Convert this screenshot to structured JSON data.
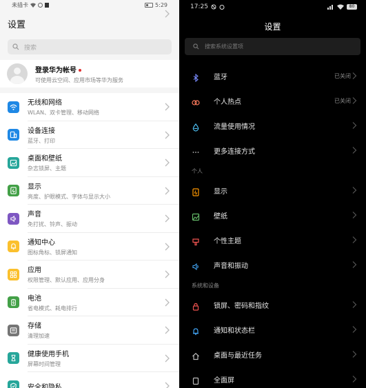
{
  "left": {
    "status": {
      "left": "未插卡",
      "time": "5:29"
    },
    "title": "设置",
    "search_placeholder": "搜索",
    "account": {
      "name": "登录华为帐号",
      "sub": "可使用云空间、应用市场等华为服务"
    },
    "items": [
      {
        "label": "无线和网络",
        "sub": "WLAN、双卡管理、移动网络",
        "color": "#1e88e5",
        "icon": "wifi-icon"
      },
      {
        "label": "设备连接",
        "sub": "蓝牙、打印",
        "color": "#1e88e5",
        "icon": "device-connect-icon"
      },
      {
        "label": "桌面和壁纸",
        "sub": "杂志锁屏、主题",
        "color": "#26a69a",
        "icon": "wallpaper-icon"
      },
      {
        "label": "显示",
        "sub": "亮度、护眼模式、字体与显示大小",
        "color": "#43a047",
        "icon": "display-icon"
      },
      {
        "label": "声音",
        "sub": "免打扰、铃声、振动",
        "color": "#7e57c2",
        "icon": "sound-icon"
      },
      {
        "label": "通知中心",
        "sub": "图标角标、锁屏通知",
        "color": "#fbc02d",
        "icon": "notification-icon"
      },
      {
        "label": "应用",
        "sub": "权限管理、默认应用、应用分身",
        "color": "#fbc02d",
        "icon": "apps-icon"
      },
      {
        "label": "电池",
        "sub": "省电模式、耗电排行",
        "color": "#43a047",
        "icon": "battery-icon"
      },
      {
        "label": "存储",
        "sub": "清理加速",
        "color": "#757575",
        "icon": "storage-icon"
      },
      {
        "label": "健康使用手机",
        "sub": "屏幕时间管理",
        "color": "#26a69a",
        "icon": "hourglass-icon"
      },
      {
        "label": "安全和隐私",
        "sub": "",
        "color": "#26a69a",
        "icon": "shield-icon"
      }
    ]
  },
  "right": {
    "status": {
      "time": "17:25",
      "battery": "80"
    },
    "title": "设置",
    "search_placeholder": "搜索系统设置项",
    "group1": [
      {
        "label": "蓝牙",
        "value": "已关闭",
        "icon": "bluetooth-icon",
        "color": "#7a8cff"
      },
      {
        "label": "个人热点",
        "value": "已关闭",
        "icon": "hotspot-icon",
        "color": "#ff7b5c"
      },
      {
        "label": "流量使用情况",
        "value": "",
        "icon": "data-usage-icon",
        "color": "#4fc3f7"
      },
      {
        "label": "更多连接方式",
        "value": "",
        "icon": "more-icon",
        "color": "#bbbbbb"
      }
    ],
    "header2": "个人",
    "group2": [
      {
        "label": "显示",
        "icon": "display-icon",
        "color": "#ff9800"
      },
      {
        "label": "壁纸",
        "icon": "wallpaper-icon",
        "color": "#66bb6a"
      },
      {
        "label": "个性主题",
        "icon": "theme-icon",
        "color": "#ef5350"
      },
      {
        "label": "声音和振动",
        "icon": "sound-icon",
        "color": "#42a5f5"
      }
    ],
    "header3": "系统和设备",
    "group3": [
      {
        "label": "锁屏、密码和指纹",
        "icon": "lock-icon",
        "color": "#ef5350"
      },
      {
        "label": "通知和状态栏",
        "icon": "notification-icon",
        "color": "#42a5f5"
      },
      {
        "label": "桌面与最近任务",
        "icon": "home-icon",
        "color": "#bbbbbb"
      },
      {
        "label": "全面屏",
        "icon": "fullscreen-icon",
        "color": "#bbbbbb"
      }
    ]
  }
}
